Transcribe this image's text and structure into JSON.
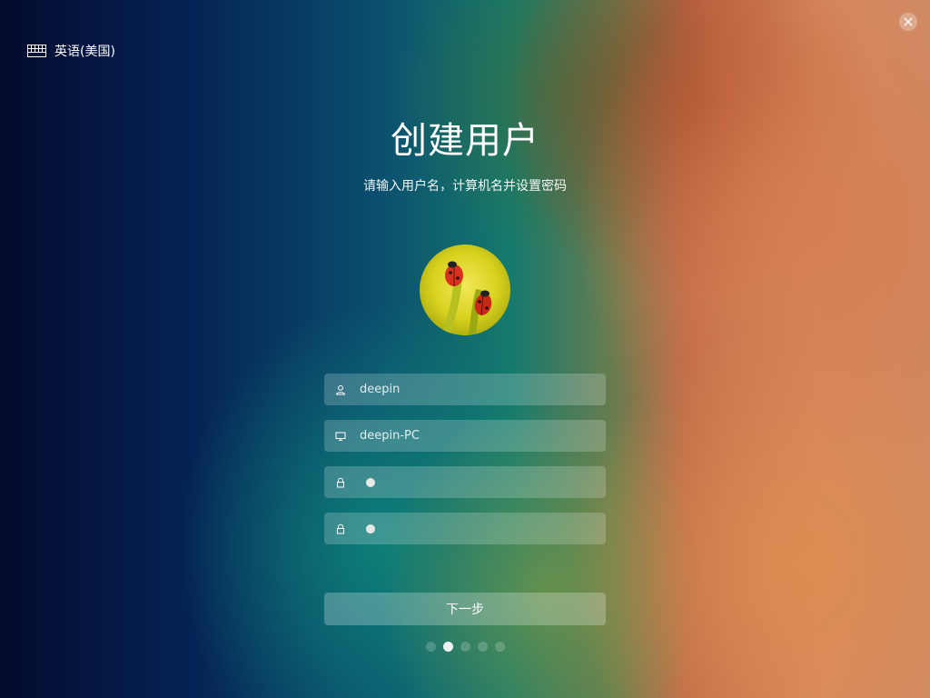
{
  "language": {
    "label": "英语(美国)",
    "icon": "keyboard-icon"
  },
  "window": {
    "close_icon": "close-icon"
  },
  "header": {
    "title": "创建用户",
    "subtitle": "请输入用户名，计算机名并设置密码"
  },
  "avatar": {
    "description_icon": "ladybug-avatar"
  },
  "form": {
    "username": {
      "icon": "user-icon",
      "value": "deepin"
    },
    "hostname": {
      "icon": "computer-icon",
      "value": "deepin-PC"
    },
    "password": {
      "icon": "lock-icon",
      "masked_length": 1
    },
    "confirm_password": {
      "icon": "lock-icon",
      "masked_length": 1
    }
  },
  "actions": {
    "next_label": "下一步"
  },
  "progress": {
    "total_steps": 5,
    "current_step": 2
  },
  "colors": {
    "active_dot": "#eef2f2",
    "field_bg": "rgba(255,255,255,0.2)"
  }
}
